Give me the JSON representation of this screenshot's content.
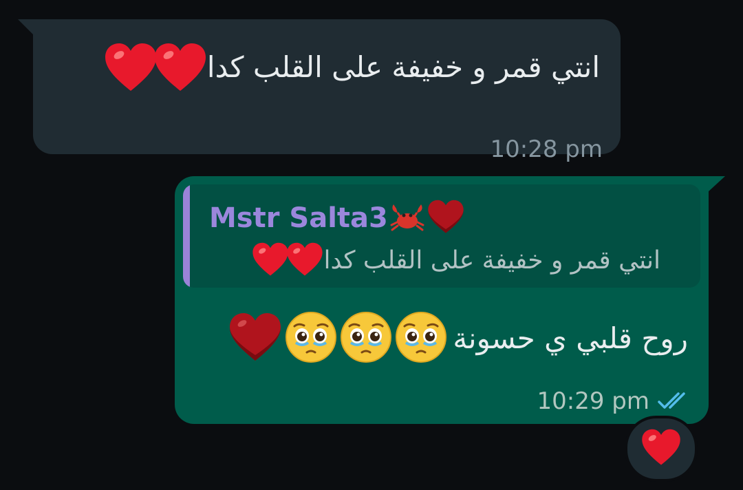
{
  "messages": {
    "incoming": {
      "text": "انتي قمر و خفيفة على القلب كدا",
      "time": "10:28 pm",
      "emoji": [
        "red-heart-icon",
        "red-heart-icon"
      ]
    },
    "outgoing": {
      "reply": {
        "sender": "Mstr Salta3",
        "sender_emoji": [
          "crab-icon",
          "dark-red-heart-icon"
        ],
        "quoted_text": "انتي قمر و خفيفة على القلب كدا",
        "quoted_emoji": [
          "red-heart-icon",
          "red-heart-icon"
        ]
      },
      "text": "روح قلبي ي حسونة",
      "emoji": [
        "pleading-face-icon",
        "pleading-face-icon",
        "pleading-face-icon",
        "dark-red-heart-icon"
      ],
      "time": "10:29 pm",
      "status": "read-double-check-icon"
    },
    "reaction": {
      "emoji": "red-heart-icon"
    }
  },
  "colors": {
    "background": "#0b0d10",
    "incoming_bubble": "#202c33",
    "outgoing_bubble": "#005c4b",
    "reply_accent": "#9a83d8",
    "read_tick": "#53bdeb"
  }
}
